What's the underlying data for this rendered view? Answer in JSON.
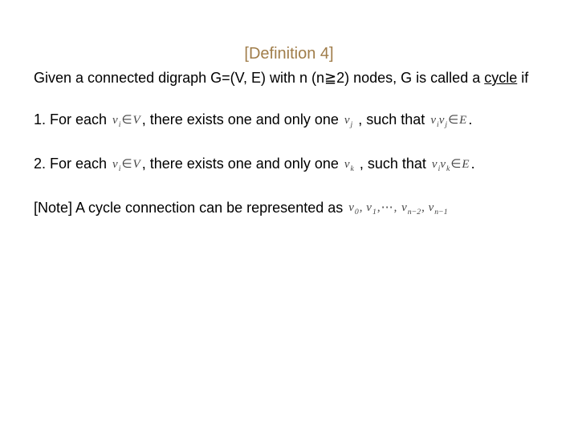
{
  "title": "[Definition 4]",
  "intro": {
    "pre": "Given a connected digraph G=(V, E) with n (n≧2) nodes, G is called a ",
    "underlined": "cycle",
    "post": " if"
  },
  "items": [
    {
      "lead": "1. For each ",
      "math1": {
        "var": "v",
        "sub": "i",
        "op": "∈",
        "set": "V"
      },
      "mid": ", there exists one and only one ",
      "math2": {
        "var": "v",
        "sub": "j"
      },
      "after2": " , such that ",
      "math3": {
        "text": "v_i v_j ∈ E"
      },
      "tail": "."
    },
    {
      "lead": "2. For each ",
      "math1": {
        "var": "v",
        "sub": "i",
        "op": "∈",
        "set": "V"
      },
      "mid": ", there exists one and only one ",
      "math2": {
        "var": "v",
        "sub": "k"
      },
      "after2": " , such that ",
      "math3": {
        "text": "v_i v_k ∈ E"
      },
      "tail": "."
    }
  ],
  "note": {
    "lead": "[Note] A cycle connection can be represented as ",
    "seq": [
      "v_0",
      "v_1",
      "…",
      "v_{n-2}",
      "v_{n-1}"
    ]
  }
}
